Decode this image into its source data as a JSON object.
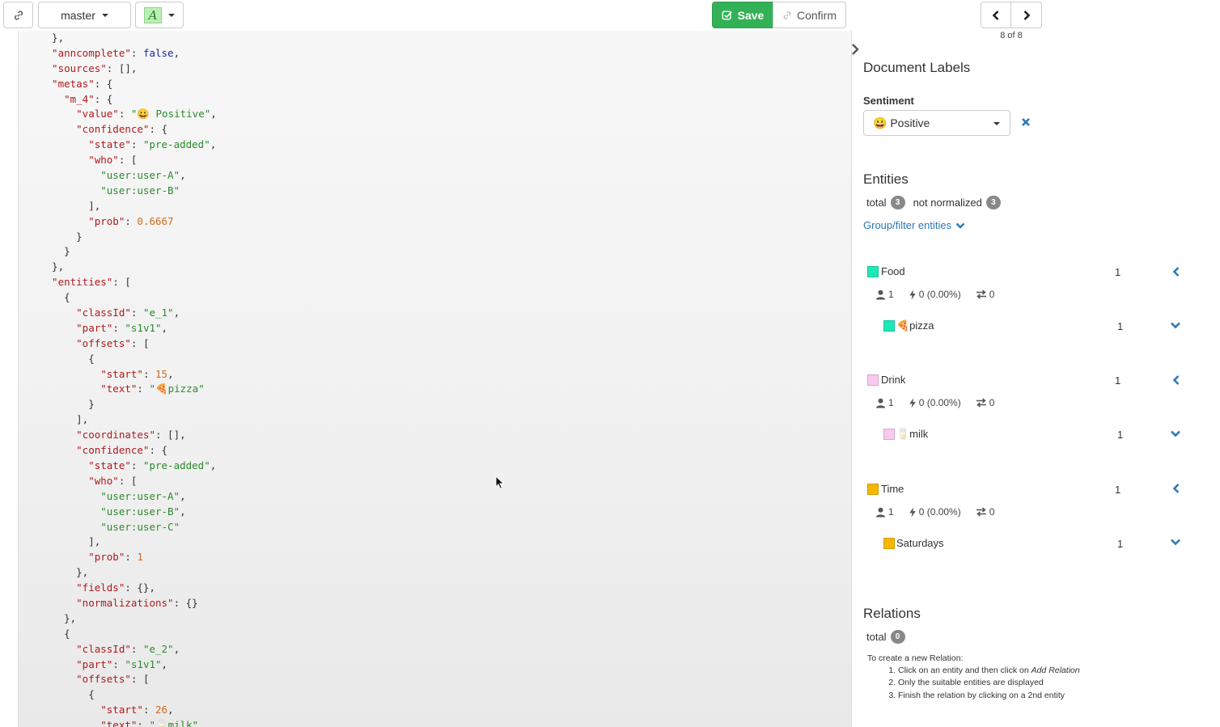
{
  "toolbar": {
    "branch_label": "master",
    "annot_letter": "A",
    "save_label": "Save",
    "confirm_label": "Confirm",
    "page_counter": "8 of 8"
  },
  "code_lines": [
    [
      {
        "t": "p",
        "v": "  },"
      }
    ],
    [
      {
        "t": "k",
        "v": "  \"anncomplete\""
      },
      {
        "t": "p",
        "v": ": "
      },
      {
        "t": "b",
        "v": "false"
      },
      {
        "t": "p",
        "v": ","
      }
    ],
    [
      {
        "t": "k",
        "v": "  \"sources\""
      },
      {
        "t": "p",
        "v": ": [],"
      }
    ],
    [
      {
        "t": "k",
        "v": "  \"metas\""
      },
      {
        "t": "p",
        "v": ": {"
      }
    ],
    [
      {
        "t": "k",
        "v": "    \"m_4\""
      },
      {
        "t": "p",
        "v": ": {"
      }
    ],
    [
      {
        "t": "k",
        "v": "      \"value\""
      },
      {
        "t": "p",
        "v": ": "
      },
      {
        "t": "s",
        "v": "\"😀 Positive\""
      },
      {
        "t": "p",
        "v": ","
      }
    ],
    [
      {
        "t": "k",
        "v": "      \"confidence\""
      },
      {
        "t": "p",
        "v": ": {"
      }
    ],
    [
      {
        "t": "k",
        "v": "        \"state\""
      },
      {
        "t": "p",
        "v": ": "
      },
      {
        "t": "s",
        "v": "\"pre-added\""
      },
      {
        "t": "p",
        "v": ","
      }
    ],
    [
      {
        "t": "k",
        "v": "        \"who\""
      },
      {
        "t": "p",
        "v": ": ["
      }
    ],
    [
      {
        "t": "s",
        "v": "          \"user:user-A\""
      },
      {
        "t": "p",
        "v": ","
      }
    ],
    [
      {
        "t": "s",
        "v": "          \"user:user-B\""
      }
    ],
    [
      {
        "t": "p",
        "v": "        ],"
      }
    ],
    [
      {
        "t": "k",
        "v": "        \"prob\""
      },
      {
        "t": "p",
        "v": ": "
      },
      {
        "t": "n",
        "v": "0.6667"
      }
    ],
    [
      {
        "t": "p",
        "v": "      }"
      }
    ],
    [
      {
        "t": "p",
        "v": "    }"
      }
    ],
    [
      {
        "t": "p",
        "v": "  },"
      }
    ],
    [
      {
        "t": "k",
        "v": "  \"entities\""
      },
      {
        "t": "p",
        "v": ": ["
      }
    ],
    [
      {
        "t": "p",
        "v": "    {"
      }
    ],
    [
      {
        "t": "k",
        "v": "      \"classId\""
      },
      {
        "t": "p",
        "v": ": "
      },
      {
        "t": "s",
        "v": "\"e_1\""
      },
      {
        "t": "p",
        "v": ","
      }
    ],
    [
      {
        "t": "k",
        "v": "      \"part\""
      },
      {
        "t": "p",
        "v": ": "
      },
      {
        "t": "s",
        "v": "\"s1v1\""
      },
      {
        "t": "p",
        "v": ","
      }
    ],
    [
      {
        "t": "k",
        "v": "      \"offsets\""
      },
      {
        "t": "p",
        "v": ": ["
      }
    ],
    [
      {
        "t": "p",
        "v": "        {"
      }
    ],
    [
      {
        "t": "k",
        "v": "          \"start\""
      },
      {
        "t": "p",
        "v": ": "
      },
      {
        "t": "n",
        "v": "15"
      },
      {
        "t": "p",
        "v": ","
      }
    ],
    [
      {
        "t": "k",
        "v": "          \"text\""
      },
      {
        "t": "p",
        "v": ": "
      },
      {
        "t": "s",
        "v": "\"🍕pizza\""
      }
    ],
    [
      {
        "t": "p",
        "v": "        }"
      }
    ],
    [
      {
        "t": "p",
        "v": "      ],"
      }
    ],
    [
      {
        "t": "k",
        "v": "      \"coordinates\""
      },
      {
        "t": "p",
        "v": ": [],"
      }
    ],
    [
      {
        "t": "k",
        "v": "      \"confidence\""
      },
      {
        "t": "p",
        "v": ": {"
      }
    ],
    [
      {
        "t": "k",
        "v": "        \"state\""
      },
      {
        "t": "p",
        "v": ": "
      },
      {
        "t": "s",
        "v": "\"pre-added\""
      },
      {
        "t": "p",
        "v": ","
      }
    ],
    [
      {
        "t": "k",
        "v": "        \"who\""
      },
      {
        "t": "p",
        "v": ": ["
      }
    ],
    [
      {
        "t": "s",
        "v": "          \"user:user-A\""
      },
      {
        "t": "p",
        "v": ","
      }
    ],
    [
      {
        "t": "s",
        "v": "          \"user:user-B\""
      },
      {
        "t": "p",
        "v": ","
      }
    ],
    [
      {
        "t": "s",
        "v": "          \"user:user-C\""
      }
    ],
    [
      {
        "t": "p",
        "v": "        ],"
      }
    ],
    [
      {
        "t": "k",
        "v": "        \"prob\""
      },
      {
        "t": "p",
        "v": ": "
      },
      {
        "t": "n",
        "v": "1"
      }
    ],
    [
      {
        "t": "p",
        "v": "      },"
      }
    ],
    [
      {
        "t": "k",
        "v": "      \"fields\""
      },
      {
        "t": "p",
        "v": ": {},"
      }
    ],
    [
      {
        "t": "k",
        "v": "      \"normalizations\""
      },
      {
        "t": "p",
        "v": ": {}"
      }
    ],
    [
      {
        "t": "p",
        "v": "    },"
      }
    ],
    [
      {
        "t": "p",
        "v": "    {"
      }
    ],
    [
      {
        "t": "k",
        "v": "      \"classId\""
      },
      {
        "t": "p",
        "v": ": "
      },
      {
        "t": "s",
        "v": "\"e_2\""
      },
      {
        "t": "p",
        "v": ","
      }
    ],
    [
      {
        "t": "k",
        "v": "      \"part\""
      },
      {
        "t": "p",
        "v": ": "
      },
      {
        "t": "s",
        "v": "\"s1v1\""
      },
      {
        "t": "p",
        "v": ","
      }
    ],
    [
      {
        "t": "k",
        "v": "      \"offsets\""
      },
      {
        "t": "p",
        "v": ": ["
      }
    ],
    [
      {
        "t": "p",
        "v": "        {"
      }
    ],
    [
      {
        "t": "k",
        "v": "          \"start\""
      },
      {
        "t": "p",
        "v": ": "
      },
      {
        "t": "n",
        "v": "26"
      },
      {
        "t": "p",
        "v": ","
      }
    ],
    [
      {
        "t": "k",
        "v": "          \"text\""
      },
      {
        "t": "p",
        "v": ": "
      },
      {
        "t": "s",
        "v": "\"🥛milk\""
      }
    ]
  ],
  "panel": {
    "title": "Document Labels",
    "sentiment_label": "Sentiment",
    "sentiment_value": "😀 Positive",
    "entities_title": "Entities",
    "total_label": "total",
    "total_count": "3",
    "not_normalized_label": "not normalized",
    "not_normalized_count": "3",
    "group_filter_label": "Group/filter entities",
    "relations_title": "Relations",
    "relations_total_label": "total",
    "relations_total_count": "0",
    "relations_help_intro": "To create a new Relation:",
    "relations_help_1a": "Click on an entity and then click on ",
    "relations_help_1b": "Add Relation",
    "relations_help_2": "Only the suitable entities are displayed",
    "relations_help_3": "Finish the relation by clicking on a 2nd entity"
  },
  "entity_groups": [
    {
      "name": "Food",
      "color": "#1de9b6",
      "count": "1",
      "users": "1",
      "auto": "0 (0.00%)",
      "relations": "0",
      "item_label": "🍕pizza",
      "item_count": "1"
    },
    {
      "name": "Drink",
      "color": "#f8c8f0",
      "count": "1",
      "users": "1",
      "auto": "0 (0.00%)",
      "relations": "0",
      "item_label": "🥛milk",
      "item_count": "1"
    },
    {
      "name": "Time",
      "color": "#f5b800",
      "count": "1",
      "users": "1",
      "auto": "0 (0.00%)",
      "relations": "0",
      "item_label": "Saturdays",
      "item_count": "1"
    }
  ],
  "colors": {
    "save": "#33b156",
    "link": "#2a7ab8",
    "badge": "#888888"
  }
}
